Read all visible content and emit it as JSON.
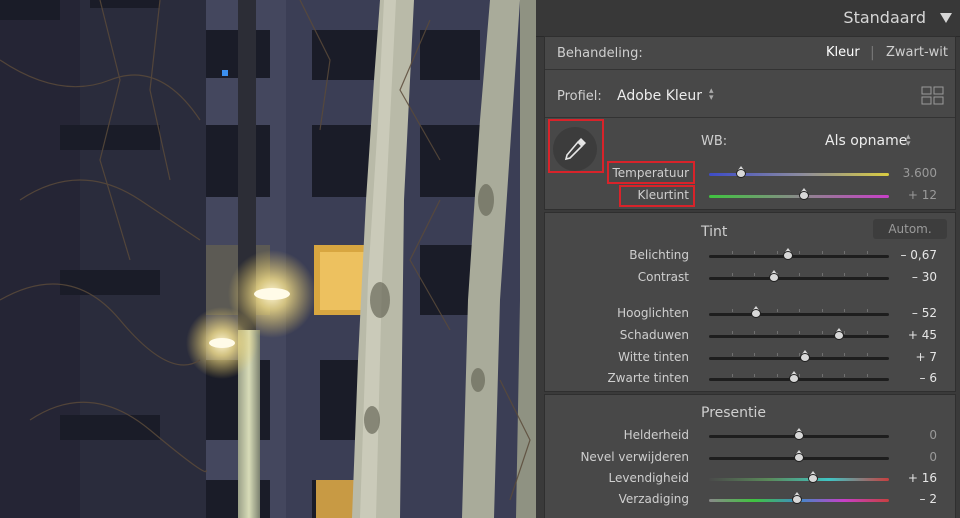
{
  "panel": {
    "title": "Standaard",
    "treatment": {
      "label": "Behandeling:",
      "options": [
        "Kleur",
        "Zwart-wit"
      ],
      "selected": "Kleur"
    },
    "profile": {
      "label": "Profiel:",
      "value": "Adobe Kleur"
    },
    "wb": {
      "label": "WB:",
      "value": "Als opname",
      "sliders": [
        {
          "label": "Temperatuur",
          "value": "3.600",
          "position": 0.18
        },
        {
          "label": "Kleurtint",
          "value": "+ 12",
          "position": 0.53
        }
      ]
    },
    "tone": {
      "title": "Tint",
      "auto_label": "Autom.",
      "sliders": [
        {
          "label": "Belichting",
          "value": "– 0,67",
          "position": 0.44
        },
        {
          "label": "Contrast",
          "value": "– 30",
          "position": 0.36
        },
        {
          "label": "Hooglichten",
          "value": "– 52",
          "position": 0.26
        },
        {
          "label": "Schaduwen",
          "value": "+ 45",
          "position": 0.72
        },
        {
          "label": "Witte tinten",
          "value": "+ 7",
          "position": 0.535
        },
        {
          "label": "Zwarte tinten",
          "value": "– 6",
          "position": 0.47
        }
      ]
    },
    "presence": {
      "title": "Presentie",
      "sliders": [
        {
          "label": "Helderheid",
          "value": "0",
          "position": 0.5
        },
        {
          "label": "Nevel verwijderen",
          "value": "0",
          "position": 0.5
        },
        {
          "label": "Levendigheid",
          "value": "+ 16",
          "position": 0.58
        },
        {
          "label": "Verzadiging",
          "value": "– 2",
          "position": 0.49
        }
      ]
    }
  }
}
